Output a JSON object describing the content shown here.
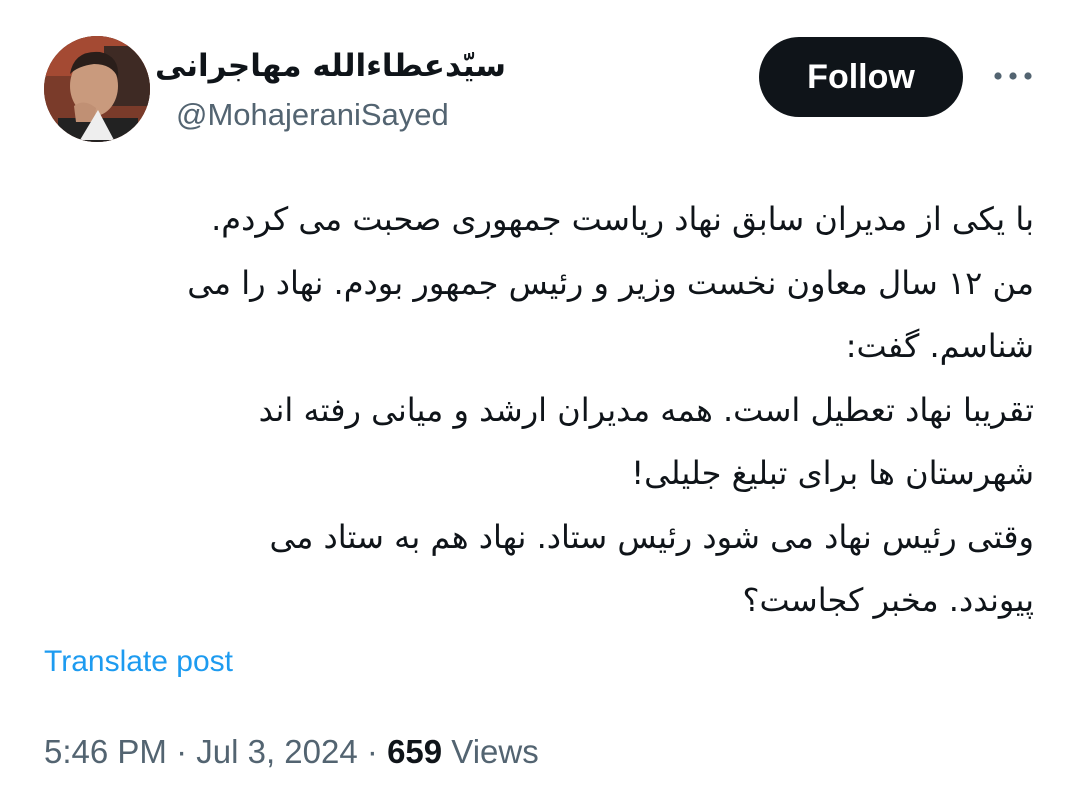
{
  "user": {
    "display_name": "سیّدعطاءالله مهاجرانی",
    "handle": "@MohajeraniSayed",
    "avatar_icon": "profile-photo"
  },
  "actions": {
    "follow_label": "Follow",
    "more_icon": "more-horizontal-icon"
  },
  "tweet": {
    "lines": [
      "با یکی از مدیران سابق نهاد ریاست جمهوری صحبت می کردم.",
      "من ۱۲ سال معاون نخست وزیر و رئیس جمهور بودم. نهاد را می",
      "شناسم. گفت:",
      "تقریبا نهاد تعطیل است. همه مدیران ارشد و میانی رفته اند",
      "شهرستان ها برای تبلیغ جلیلی!",
      "وقتی رئیس نهاد می شود رئیس ستاد. نهاد هم به ستاد می",
      "پیوندد. مخبر کجاست؟"
    ],
    "translate_label": "Translate post"
  },
  "meta": {
    "time": "5:46 PM",
    "separator": "·",
    "date": "Jul 3, 2024",
    "views_count": "659",
    "views_label": "Views"
  },
  "colors": {
    "text": "#0f1419",
    "secondary": "#536471",
    "link": "#1d9bf0",
    "button_bg": "#0f1419"
  }
}
